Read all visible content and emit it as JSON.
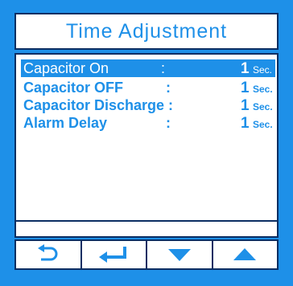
{
  "title": "Time Adjustment",
  "rows": [
    {
      "label": "Capacitor  On",
      "colon": ":",
      "value": "1",
      "unit": "Sec."
    },
    {
      "label": "Capacitor OFF",
      "colon": ":",
      "value": "1",
      "unit": "Sec."
    },
    {
      "label": "Capacitor Discharge :",
      "colon": "",
      "value": "1",
      "unit": "Sec."
    },
    {
      "label": "Alarm Delay",
      "colon": ":",
      "value": "1",
      "unit": "Sec."
    }
  ],
  "buttons": [
    {
      "icon": "back-arrow-icon"
    },
    {
      "icon": "enter-icon"
    },
    {
      "icon": "down-triangle-icon"
    },
    {
      "icon": "up-triangle-icon"
    }
  ],
  "colors": {
    "accent": "#1e90e8",
    "border": "#0b2e63",
    "background": "#ffffff"
  }
}
